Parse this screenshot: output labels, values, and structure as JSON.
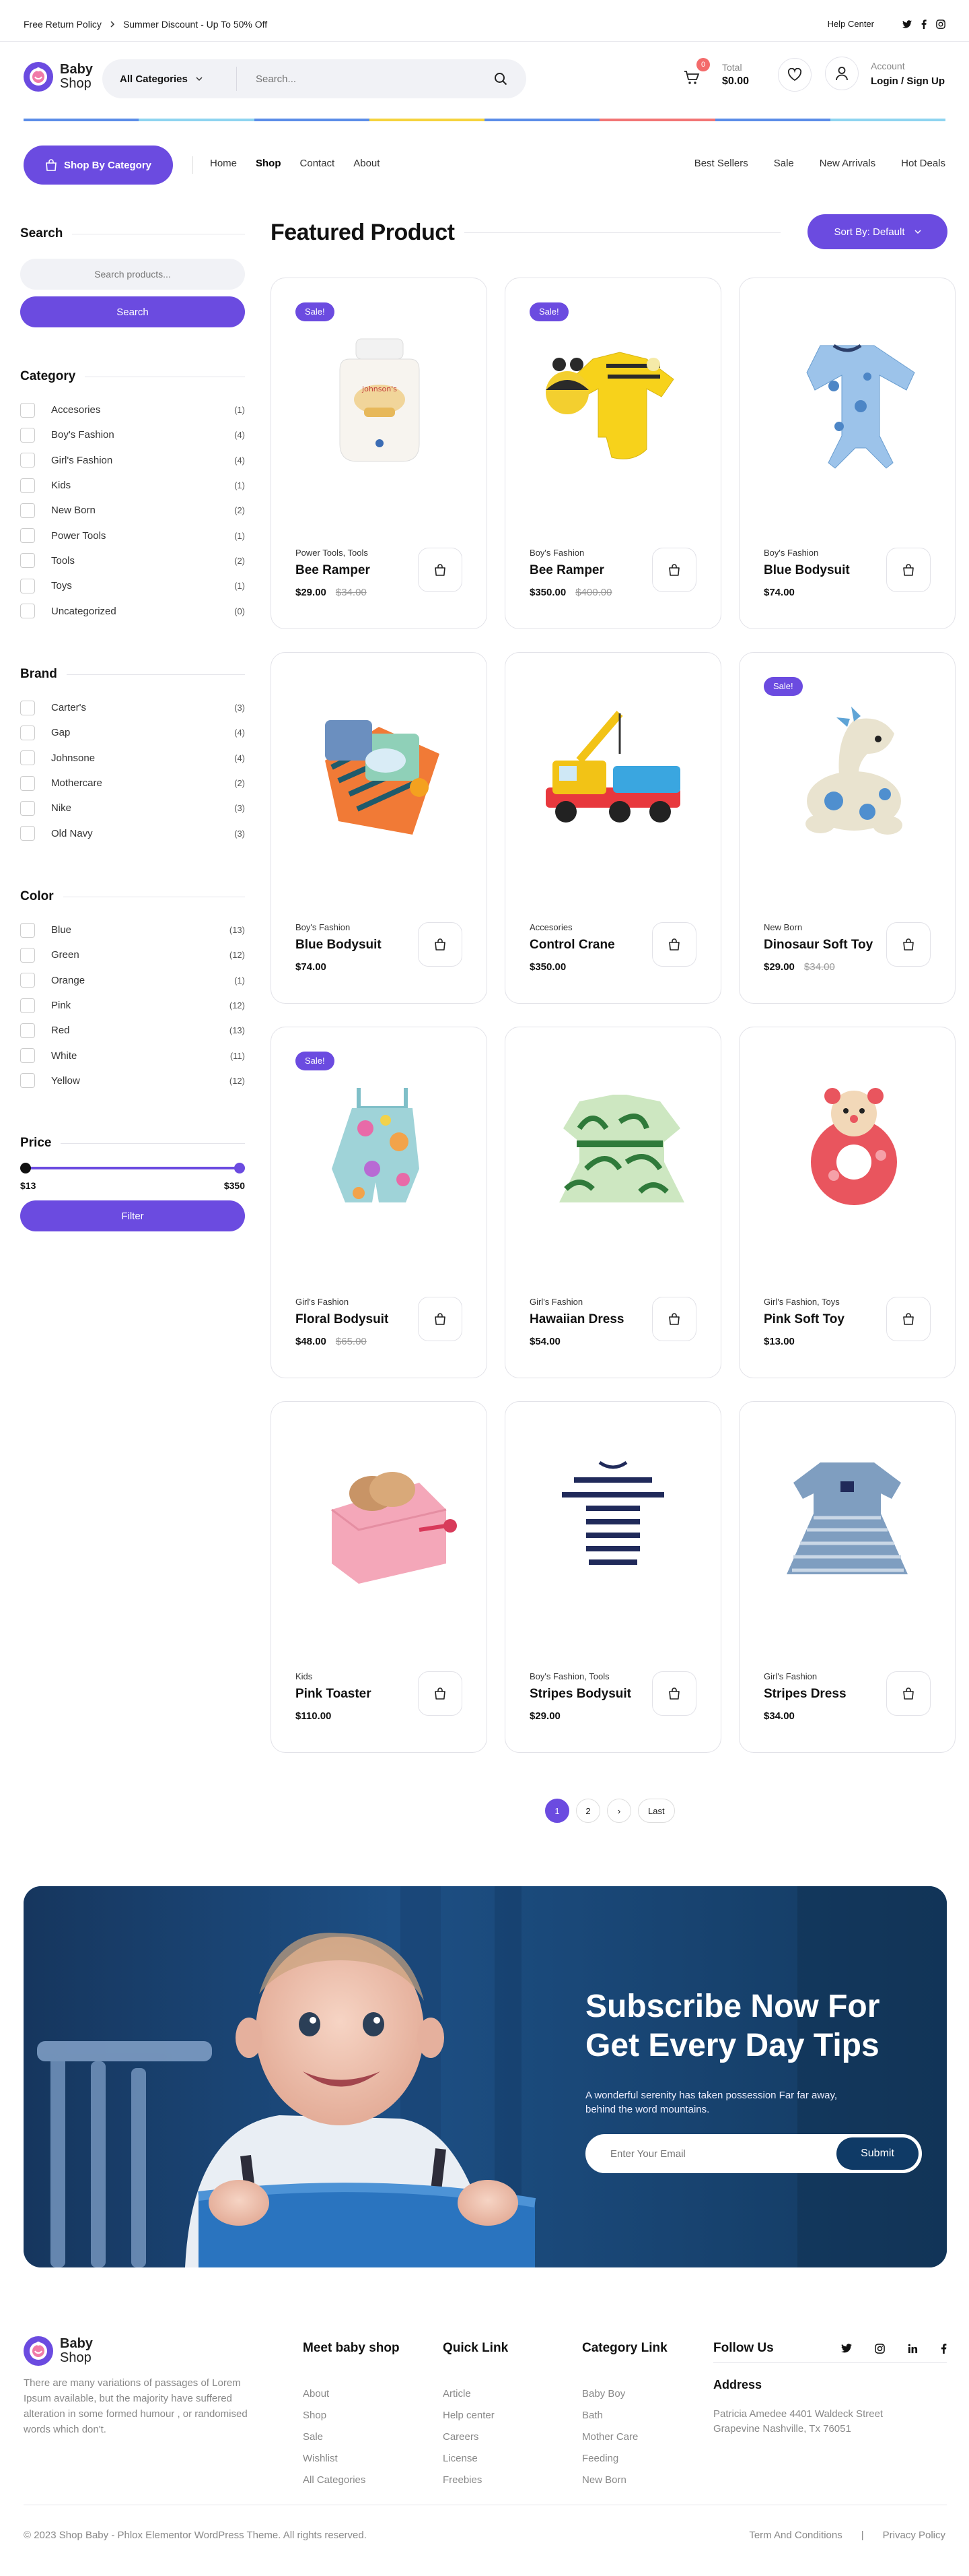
{
  "topbar": {
    "return_policy": "Free Return Policy",
    "discount": "Summer Discount - Up To 50% Off",
    "help": "Help Center",
    "social": [
      "twitter-icon",
      "facebook-icon",
      "instagram-icon"
    ]
  },
  "logo": {
    "line1": "Baby",
    "line2": "Shop"
  },
  "header": {
    "category_select": "All Categories",
    "search_placeholder": "Search...",
    "cart_count": "0",
    "total_label": "Total",
    "total_value": "$0.00",
    "account_label": "Account",
    "login_label": "Login / Sign Up"
  },
  "nav": {
    "category_button": "Shop By Category",
    "links": [
      "Home",
      "Shop",
      "Contact",
      "About"
    ],
    "active": "Shop",
    "right_links": [
      "Best Sellers",
      "Sale",
      "New Arrivals",
      "Hot Deals"
    ]
  },
  "colors": {
    "accent": "#6b4be0",
    "strip": [
      "#5b8de8",
      "#8ed4f0",
      "#5b8de8",
      "#f5d33d",
      "#5b8de8",
      "#f27575",
      "#5b8de8",
      "#8ed4f0"
    ]
  },
  "sidebar": {
    "search": {
      "title": "Search",
      "placeholder": "Search products...",
      "button": "Search"
    },
    "category": {
      "title": "Category",
      "items": [
        {
          "name": "Accesories",
          "count": "(1)"
        },
        {
          "name": "Boy's Fashion",
          "count": "(4)"
        },
        {
          "name": "Girl's Fashion",
          "count": "(4)"
        },
        {
          "name": "Kids",
          "count": "(1)"
        },
        {
          "name": "New Born",
          "count": "(2)"
        },
        {
          "name": "Power Tools",
          "count": "(1)"
        },
        {
          "name": "Tools",
          "count": "(2)"
        },
        {
          "name": "Toys",
          "count": "(1)"
        },
        {
          "name": "Uncategorized",
          "count": "(0)"
        }
      ]
    },
    "brand": {
      "title": "Brand",
      "items": [
        {
          "name": "Carter's",
          "count": "(3)"
        },
        {
          "name": "Gap",
          "count": "(4)"
        },
        {
          "name": "Johnsone",
          "count": "(4)"
        },
        {
          "name": "Mothercare",
          "count": "(2)"
        },
        {
          "name": "Nike",
          "count": "(3)"
        },
        {
          "name": "Old Navy",
          "count": "(3)"
        }
      ]
    },
    "color": {
      "title": "Color",
      "items": [
        {
          "name": "Blue",
          "count": "(13)"
        },
        {
          "name": "Green",
          "count": "(12)"
        },
        {
          "name": "Orange",
          "count": "(1)"
        },
        {
          "name": "Pink",
          "count": "(12)"
        },
        {
          "name": "Red",
          "count": "(13)"
        },
        {
          "name": "White",
          "count": "(11)"
        },
        {
          "name": "Yellow",
          "count": "(12)"
        }
      ]
    },
    "price": {
      "title": "Price",
      "min": "$13",
      "max": "$350",
      "button": "Filter"
    }
  },
  "products_section": {
    "title": "Featured Product",
    "sort": "Sort By: Default"
  },
  "products": [
    {
      "sale": "Sale!",
      "category": "Power Tools, Tools",
      "name": "Bee Ramper",
      "price": "$29.00",
      "old_price": "$34.00",
      "image": "baby-shampoo-bottle"
    },
    {
      "sale": "Sale!",
      "category": "Boy's Fashion",
      "name": "Bee Ramper",
      "price": "$350.00",
      "old_price": "$400.00",
      "image": "yellow-bee-romper"
    },
    {
      "sale": "",
      "category": "Boy's Fashion",
      "name": "Blue Bodysuit",
      "price": "$74.00",
      "old_price": "",
      "image": "blue-bodysuit"
    },
    {
      "sale": "",
      "category": "Boy's Fashion",
      "name": "Blue Bodysuit",
      "price": "$74.00",
      "old_price": "",
      "image": "baby-clothes-pile"
    },
    {
      "sale": "",
      "category": "Accesories",
      "name": "Control Crane",
      "price": "$350.00",
      "old_price": "",
      "image": "toy-crane-truck"
    },
    {
      "sale": "Sale!",
      "category": "New Born",
      "name": "Dinosaur Soft Toy",
      "price": "$29.00",
      "old_price": "$34.00",
      "image": "dinosaur-plush"
    },
    {
      "sale": "Sale!",
      "category": "Girl's Fashion",
      "name": "Floral Bodysuit",
      "price": "$48.00",
      "old_price": "$65.00",
      "image": "floral-romper"
    },
    {
      "sale": "",
      "category": "Girl's Fashion",
      "name": "Hawaiian Dress",
      "price": "$54.00",
      "old_price": "",
      "image": "hawaiian-dress"
    },
    {
      "sale": "",
      "category": "Girl's Fashion, Toys",
      "name": "Pink Soft Toy",
      "price": "$13.00",
      "old_price": "",
      "image": "pink-ring-toy"
    },
    {
      "sale": "",
      "category": "Kids",
      "name": "Pink Toaster",
      "price": "$110.00",
      "old_price": "",
      "image": "pink-toy-toaster"
    },
    {
      "sale": "",
      "category": "Boy's Fashion, Tools",
      "name": "Stripes Bodysuit",
      "price": "$29.00",
      "old_price": "",
      "image": "striped-bodysuit"
    },
    {
      "sale": "",
      "category": "Girl's Fashion",
      "name": "Stripes Dress",
      "price": "$34.00",
      "old_price": "",
      "image": "striped-dress"
    }
  ],
  "pagination": [
    "1",
    "2",
    "›",
    "Last"
  ],
  "subscribe": {
    "title_line1": "Subscribe Now For",
    "title_line2": "Get Every Day Tips",
    "text_line1": "A wonderful serenity has taken possession Far far away,",
    "text_line2": "behind the word mountains.",
    "placeholder": "Enter Your Email",
    "button": "Submit"
  },
  "footer": {
    "description": "There are many variations of passages of Lorem Ipsum available, but the majority have suffered alteration in some formed humour , or randomised words which don't.",
    "col1": {
      "title": "Meet baby shop",
      "links": [
        "About",
        "Shop",
        "Sale",
        "Wishlist",
        "All Categories"
      ]
    },
    "col2": {
      "title": "Quick Link",
      "links": [
        "Article",
        "Help center",
        "Careers",
        "License",
        "Freebies"
      ]
    },
    "col3": {
      "title": "Category Link",
      "links": [
        "Baby Boy",
        "Bath",
        "Mother Care",
        "Feeding",
        "New Born"
      ]
    },
    "follow": {
      "title": "Follow Us",
      "social": [
        "twitter-icon",
        "instagram-icon",
        "linkedin-icon",
        "facebook-icon"
      ]
    },
    "address": {
      "title": "Address",
      "line1": "Patricia Amedee 4401 Waldeck Street",
      "line2": "Grapevine Nashville, Tx 76051"
    },
    "copyright": "© 2023 Shop Baby - Phlox Elementor WordPress Theme. All rights reserved.",
    "legal": [
      "Term And Conditions",
      "|",
      "Privacy Policy"
    ]
  }
}
